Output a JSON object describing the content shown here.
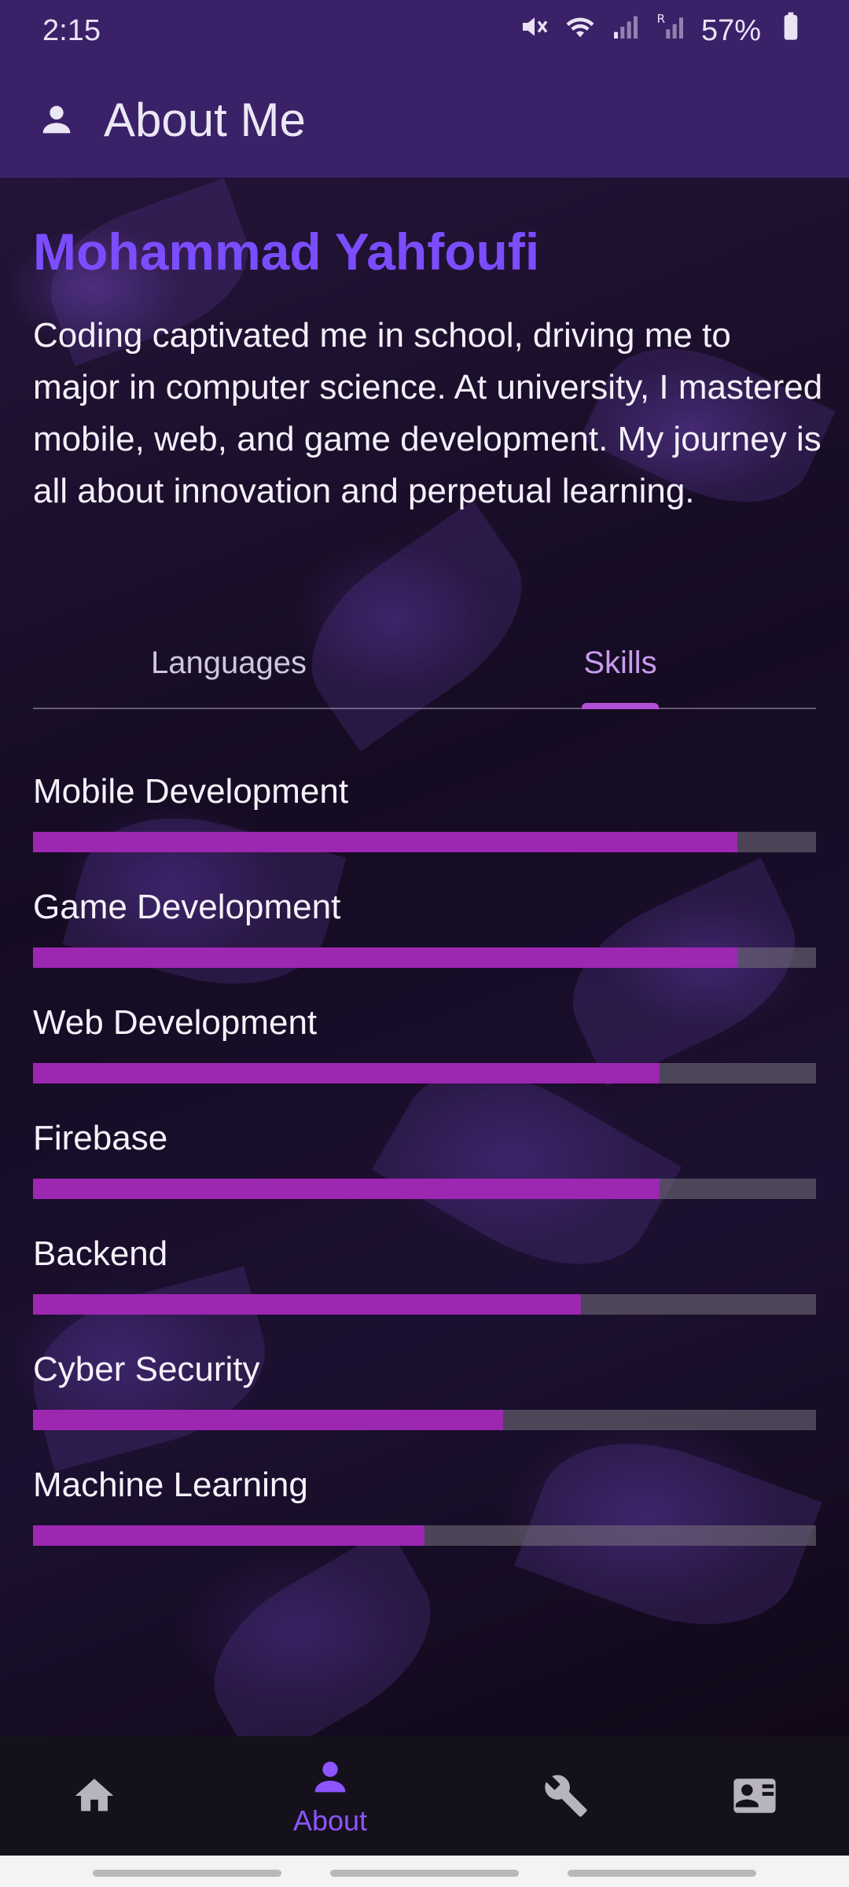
{
  "status_bar": {
    "time": "2:15",
    "battery": "57%"
  },
  "app_bar": {
    "title": "About Me"
  },
  "profile": {
    "name": "Mohammad Yahfoufi",
    "bio": "Coding captivated me in school, driving me to major in computer science. At university, I mastered mobile, web, and game development. My journey is all about innovation and perpetual learning."
  },
  "tabs": {
    "languages": "Languages",
    "skills": "Skills",
    "selected": "Skills"
  },
  "skills": [
    {
      "label": "Mobile Development",
      "level": 0.9
    },
    {
      "label": "Game Development",
      "level": 0.9
    },
    {
      "label": "Web Development",
      "level": 0.8
    },
    {
      "label": "Firebase",
      "level": 0.8
    },
    {
      "label": "Backend",
      "level": 0.7
    },
    {
      "label": "Cyber Security",
      "level": 0.6
    },
    {
      "label": "Machine Learning",
      "level": 0.5
    }
  ],
  "bottom_nav": {
    "items": [
      {
        "icon": "home-icon",
        "label": ""
      },
      {
        "icon": "person-icon",
        "label": "About"
      },
      {
        "icon": "wrench-icon",
        "label": ""
      },
      {
        "icon": "contact-card-icon",
        "label": ""
      }
    ],
    "active": "About"
  },
  "colors": {
    "accent": "#7b4dff",
    "progress": "#9c27b0",
    "app_bar": "#3a2168"
  }
}
